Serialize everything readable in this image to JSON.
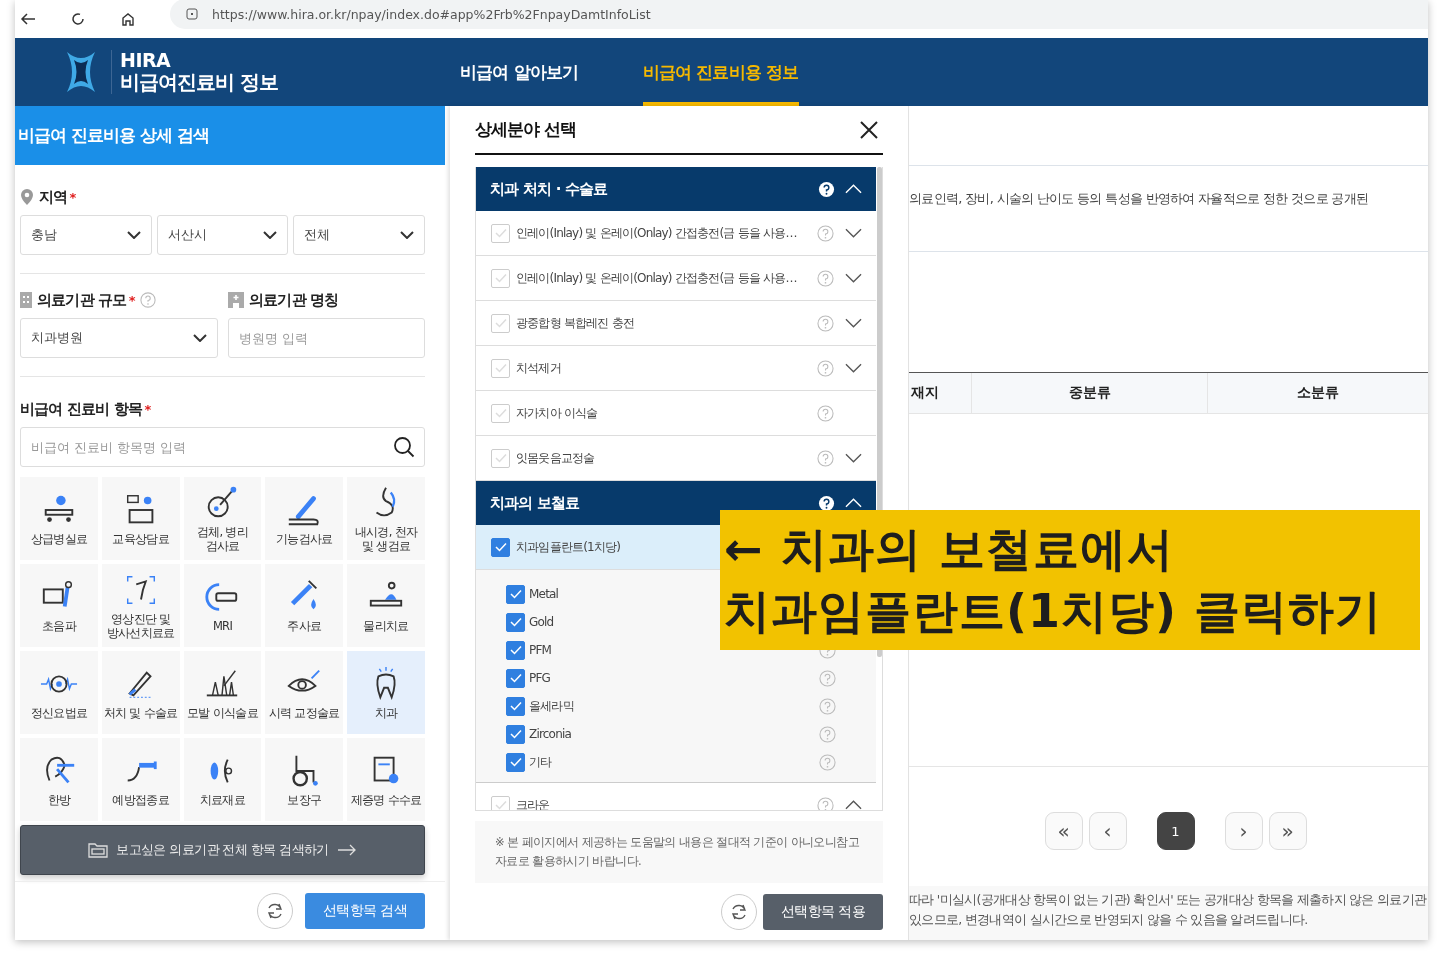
{
  "browser": {
    "url": "https://www.hira.or.kr/npay/index.do#app%2Frb%2FnpayDamtInfoList"
  },
  "header": {
    "logo_title": "HIRA",
    "logo_subtitle": "비급여진료비 정보",
    "nav": [
      {
        "label": "비급여 알아보기",
        "selected": false
      },
      {
        "label": "비급여 진료비용 정보",
        "selected": true
      }
    ]
  },
  "search_panel": {
    "title": "비급여 진료비용 상세 검색",
    "region": {
      "label": "지역",
      "required_mark": "*",
      "selects": [
        "충남",
        "서산시",
        "전체"
      ]
    },
    "size": {
      "label": "의료기관 규모",
      "required_mark": "*",
      "value": "치과병원"
    },
    "name": {
      "label": "의료기관 명칭",
      "placeholder": "병원명 입력"
    },
    "items": {
      "label": "비급여 진료비 항목",
      "required_mark": "*",
      "placeholder": "비급여 진료비 항목명 입력"
    },
    "categories": [
      {
        "label": "상급병실료",
        "selected": false
      },
      {
        "label": "교육상담료",
        "selected": false
      },
      {
        "label": "검체, 병리\n검사료",
        "selected": false
      },
      {
        "label": "기능검사료",
        "selected": false
      },
      {
        "label": "내시경, 천자\n및 생검료",
        "selected": false
      },
      {
        "label": "초음파",
        "selected": false
      },
      {
        "label": "영상진단 및\n방사선치료료",
        "selected": false
      },
      {
        "label": "MRI",
        "selected": false
      },
      {
        "label": "주사료",
        "selected": false
      },
      {
        "label": "물리치료",
        "selected": false
      },
      {
        "label": "정신요법료",
        "selected": false
      },
      {
        "label": "처치 및 수술료",
        "selected": false
      },
      {
        "label": "모발 이식술료",
        "selected": false
      },
      {
        "label": "시력 교정술료",
        "selected": false
      },
      {
        "label": "치과",
        "selected": true
      },
      {
        "label": "한방",
        "selected": false
      },
      {
        "label": "예방접종료",
        "selected": false
      },
      {
        "label": "치료재료",
        "selected": false
      },
      {
        "label": "보장구",
        "selected": false
      },
      {
        "label": "제증명 수수료",
        "selected": false
      }
    ],
    "all_items_button": "보고싶은 의료기관 전체 항목 검색하기",
    "search_button": "선택항목 검색"
  },
  "detail_modal": {
    "title": "상세분야 선택",
    "sections": [
      {
        "title": "치과 처치 · 수술료",
        "expanded": true,
        "items": [
          {
            "label": "인레이(Inlay) 및 온레이(Onlay) 간접충전(금 등을 사용…",
            "checked": false,
            "selected": false,
            "expanded": false
          },
          {
            "label": "인레이(Inlay) 및 온레이(Onlay) 간접충전(금 등을 사용…",
            "checked": false,
            "selected": false,
            "expanded": false
          },
          {
            "label": "광중합형 복합레진 충전",
            "checked": false,
            "selected": false,
            "expanded": false
          },
          {
            "label": "치석제거",
            "checked": false,
            "selected": false,
            "expanded": false
          },
          {
            "label": "자가치아 이식술",
            "checked": false,
            "selected": false
          },
          {
            "label": "잇몸웃음교정술",
            "checked": false,
            "selected": false,
            "expanded": false
          }
        ]
      },
      {
        "title": "치과의 보철료",
        "expanded": true,
        "items": [
          {
            "label": "치과임플란트(1치당)",
            "checked": true,
            "selected": true,
            "children": [
              {
                "label": "Metal",
                "checked": true,
                "help": false
              },
              {
                "label": "Gold",
                "checked": true,
                "help": false
              },
              {
                "label": "PFM",
                "checked": true,
                "help": true
              },
              {
                "label": "PFG",
                "checked": true,
                "help": true
              },
              {
                "label": "올세라믹",
                "checked": true,
                "help": true
              },
              {
                "label": "Zirconia",
                "checked": true,
                "help": true
              },
              {
                "label": "기타",
                "checked": true,
                "help": true
              }
            ]
          },
          {
            "label": "크라운",
            "checked": false,
            "selected": false,
            "expanded": true
          }
        ]
      }
    ],
    "notice": "※ 본 페이지에서 제공하는 도움말의 내용은 절대적 기준이 아니오니참고 자료로 활용하시기 바랍니다.",
    "apply_button": "선택항목 적용"
  },
  "results": {
    "description": "의료인력, 장비, 시술의 난이도 등의 특성을 반영하여 자율적으로 정한 것으로 공개된",
    "table": {
      "columns": [
        "재지",
        "중분류",
        "소분류"
      ]
    },
    "pagination": [
      {
        "label": "«",
        "kind": "nav",
        "selected": false
      },
      {
        "label": "‹",
        "kind": "nav",
        "selected": false
      },
      {
        "label": "1",
        "kind": "page",
        "selected": true
      },
      {
        "label": "›",
        "kind": "nav",
        "selected": false
      },
      {
        "label": "»",
        "kind": "nav",
        "selected": false
      }
    ],
    "footer_lines": [
      "따라 '미실시(공개대상 항목이 없는 기관) 확인서' 또는 공개대상 항목을 제출하지 않은 의료기관",
      "있으므로, 변경내역이 실시간으로 반영되지 않을 수 있음을 알려드립니다."
    ]
  },
  "annotation": {
    "lines": [
      "← 치과의 보철료에서",
      "치과임플란트(1치당) 클릭하기"
    ]
  }
}
